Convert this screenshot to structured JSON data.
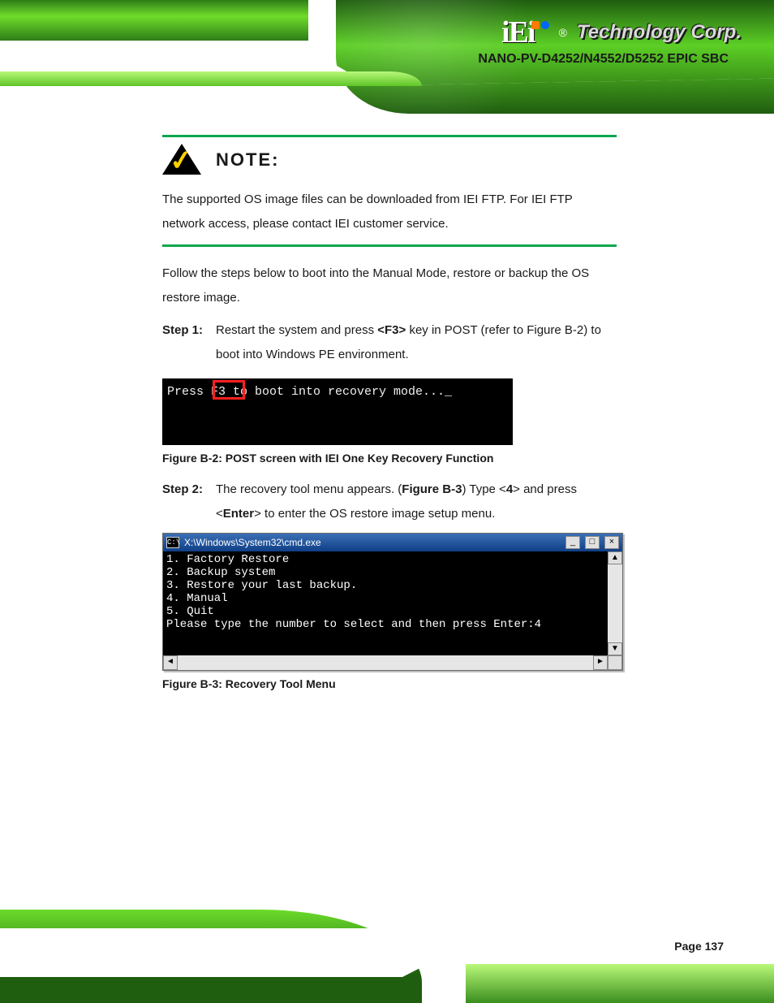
{
  "header": {
    "brand_logo_text": "iEi",
    "brand_text": "Technology Corp.",
    "product_name": "NANO-PV-D4252/N4552/D5252 EPIC SBC"
  },
  "note": {
    "label": "NOTE:",
    "body": "The supported OS image files can be downloaded from IEI FTP. For IEI FTP network access, please contact IEI customer service."
  },
  "para1": "Follow the steps below to boot into the Manual Mode, restore or backup the OS restore image.",
  "step1": {
    "num": "Step 1:",
    "text_a": "Restart the system and press ",
    "key": "<F3>",
    "text_b": " key in POST (refer to Figure B-2) to boot into Windows PE environment."
  },
  "screenshot1": {
    "line": "Press F3 to boot into recovery mode..._"
  },
  "caption1": "Figure B-2: POST screen with IEI One Key Recovery Function",
  "step2": {
    "num": "Step 2:",
    "text_a": "The recovery tool menu appears. (",
    "ref": "Figure B-3",
    "text_b": ") Type <",
    "key": "4",
    "text_c": "> and press <",
    "enter": "Enter",
    "text_d": "> to enter the OS restore image setup menu."
  },
  "screenshot2": {
    "title": "X:\\Windows\\System32\\cmd.exe",
    "lines": [
      "1. Factory Restore",
      "2. Backup system",
      "3. Restore your last backup.",
      "4. Manual",
      "5. Quit",
      "Please type the number to select and then press Enter:4"
    ],
    "min_btn": "_",
    "max_btn": "□",
    "close_btn": "×",
    "cmd_icon_text": "C:\\"
  },
  "caption2": "Figure B-3: Recovery Tool Menu",
  "footer": {
    "page": "Page 137"
  }
}
